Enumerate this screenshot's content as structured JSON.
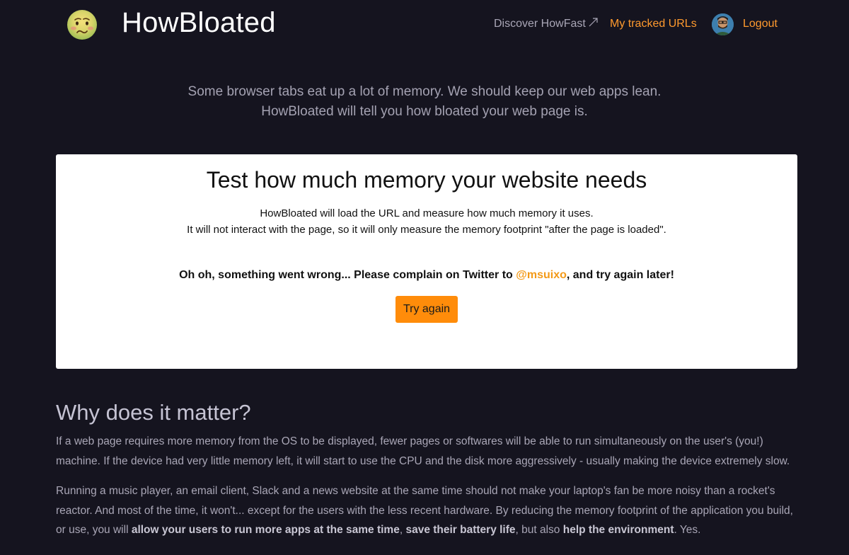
{
  "header": {
    "brand": "HowBloated",
    "logo_icon": "nauseated-face-emoji",
    "nav": {
      "discover": "Discover HowFast",
      "tracked": "My tracked URLs",
      "logout": "Logout"
    }
  },
  "intro": {
    "line1": "Some browser tabs eat up a lot of memory. We should keep our web apps lean.",
    "line2": "HowBloated will tell you how bloated your web page is."
  },
  "card": {
    "title": "Test how much memory your website needs",
    "desc1": "HowBloated will load the URL and measure how much memory it uses.",
    "desc2": "It will not interact with the page, so it will only measure the memory footprint \"after the page is loaded\".",
    "error_before": "Oh oh, something went wrong... Please complain on Twitter to ",
    "error_handle": "@msuixo",
    "error_after": ", and try again later!",
    "button": "Try again"
  },
  "why": {
    "title": "Why does it matter?",
    "p1": "If a web page requires more memory from the OS to be displayed, fewer pages or softwares will be able to run simultaneously on the user's (you!) machine. If the device had very little memory left, it will start to use the CPU and the disk more aggressively - usually making the device extremely slow.",
    "p2_a": "Running a music player, an email client, Slack and a news website at the same time should not make your laptop's fan be more noisy than a rocket's reactor. And most of the time, it won't... except for the users with the less recent hardware. By reducing the memory footprint of the application you build, or use, you will ",
    "p2_b1": "allow your users to run more apps at the same time",
    "p2_c": ", ",
    "p2_b2": "save their battery life",
    "p2_d": ", but also ",
    "p2_b3": "help the environment",
    "p2_e": ". Yes."
  },
  "colors": {
    "background": "#15141f",
    "accent": "#ff8c0a",
    "link": "#ff9a2e"
  }
}
